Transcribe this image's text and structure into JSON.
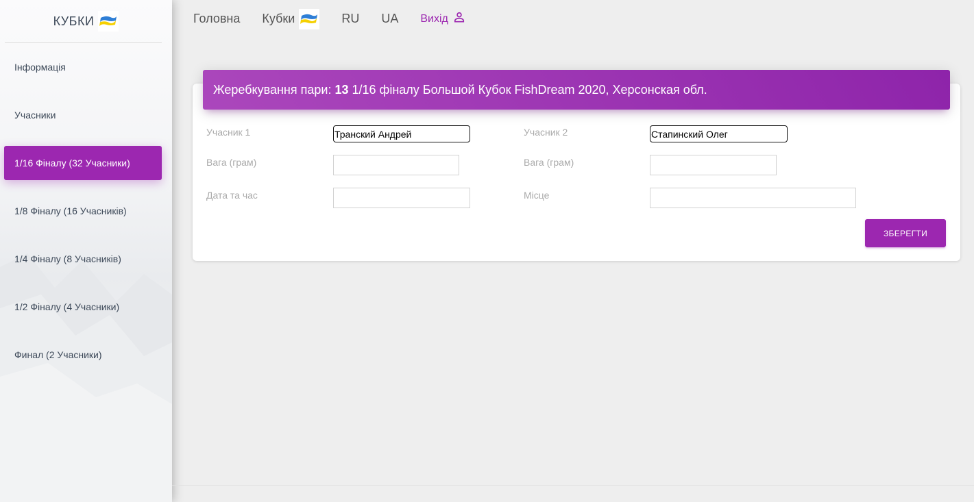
{
  "sidebar": {
    "brand": "КУБКИ",
    "brand_icon": "ukraine-flag-icon",
    "items": [
      {
        "label": "Інформація"
      },
      {
        "label": "Учасники"
      },
      {
        "label": "1/16 Фіналу (32 Учасники)",
        "active": true
      },
      {
        "label": "1/8 Фіналу (16 Учасників)"
      },
      {
        "label": "1/4 Фіналу (8 Учасників)"
      },
      {
        "label": "1/2 Фіналу (4 Учасники)"
      },
      {
        "label": "Финал (2 Учасники)"
      }
    ]
  },
  "topnav": {
    "home": "Головна",
    "cups": "Кубки",
    "ru": "RU",
    "ua": "UA",
    "logout": "Вихід",
    "logout_icon": "person-icon"
  },
  "card": {
    "title_prefix": "Жеребкування пари:",
    "pair_number": "13",
    "title_suffix": "1/16 фіналу Большой Кубок FishDream 2020, Херсонская обл.",
    "participant1_label": "Учасник 1",
    "participant1_value": "Транский Андрей",
    "participant2_label": "Учасник 2",
    "participant2_value": "Стапинский Олег",
    "weight1_label": "Вага (грам)",
    "weight1_value": "",
    "weight2_label": "Вага (грам)",
    "weight2_value": "",
    "datetime_label": "Дата та час",
    "datetime_value": "",
    "place_label": "Місце",
    "place_value": "",
    "save_label": "ЗБЕРЕГТИ"
  },
  "colors": {
    "accent": "#9c27b0",
    "background": "#eeeeee"
  }
}
